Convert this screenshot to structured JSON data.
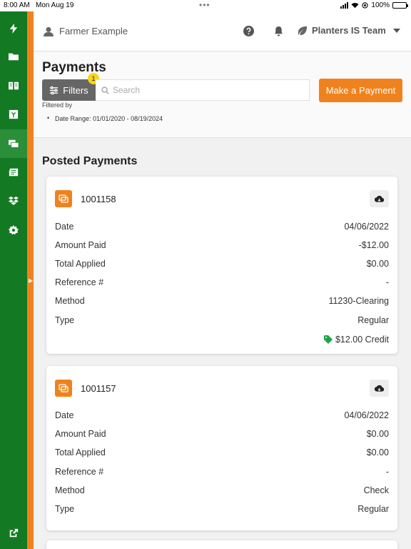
{
  "status_bar": {
    "time": "8:00 AM",
    "date": "Mon Aug 19",
    "battery": "100%"
  },
  "header": {
    "user_name": "Farmer Example",
    "team_name": "Planters IS Team"
  },
  "page": {
    "title": "Payments",
    "filters_label": "Filters",
    "filter_count": "1",
    "search_placeholder": "Search",
    "make_payment_label": "Make a Payment",
    "filtered_by_label": "Filtered by",
    "filter_date_range": "Date Range: 01/01/2020 - 08/19/2024"
  },
  "posted": {
    "title": "Posted Payments",
    "payments": [
      {
        "number": "1001158",
        "rows": [
          {
            "label": "Date",
            "value": "04/06/2022"
          },
          {
            "label": "Amount Paid",
            "value": "-$12.00"
          },
          {
            "label": "Total Applied",
            "value": "$0.00"
          },
          {
            "label": "Reference #",
            "value": "-"
          },
          {
            "label": "Method",
            "value": "11230-Clearing"
          },
          {
            "label": "Type",
            "value": "Regular"
          }
        ],
        "credit": "$12.00 Credit"
      },
      {
        "number": "1001157",
        "rows": [
          {
            "label": "Date",
            "value": "04/06/2022"
          },
          {
            "label": "Amount Paid",
            "value": "$0.00"
          },
          {
            "label": "Total Applied",
            "value": "$0.00"
          },
          {
            "label": "Reference #",
            "value": "-"
          },
          {
            "label": "Method",
            "value": "Check"
          },
          {
            "label": "Type",
            "value": "Regular"
          }
        ]
      }
    ]
  },
  "sidebar": {
    "items": [
      {
        "icon": "bolt-icon"
      },
      {
        "icon": "folder-icon"
      },
      {
        "icon": "book-icon"
      },
      {
        "icon": "invoice-icon"
      },
      {
        "icon": "payments-icon"
      },
      {
        "icon": "newspaper-icon"
      },
      {
        "icon": "dropbox-icon"
      },
      {
        "icon": "settings-icon"
      },
      {
        "icon": "external-link-icon"
      }
    ]
  },
  "colors": {
    "sidebar": "#137a23",
    "accent": "#f0821e",
    "badge": "#f7d51d",
    "credit": "#1da34a"
  }
}
